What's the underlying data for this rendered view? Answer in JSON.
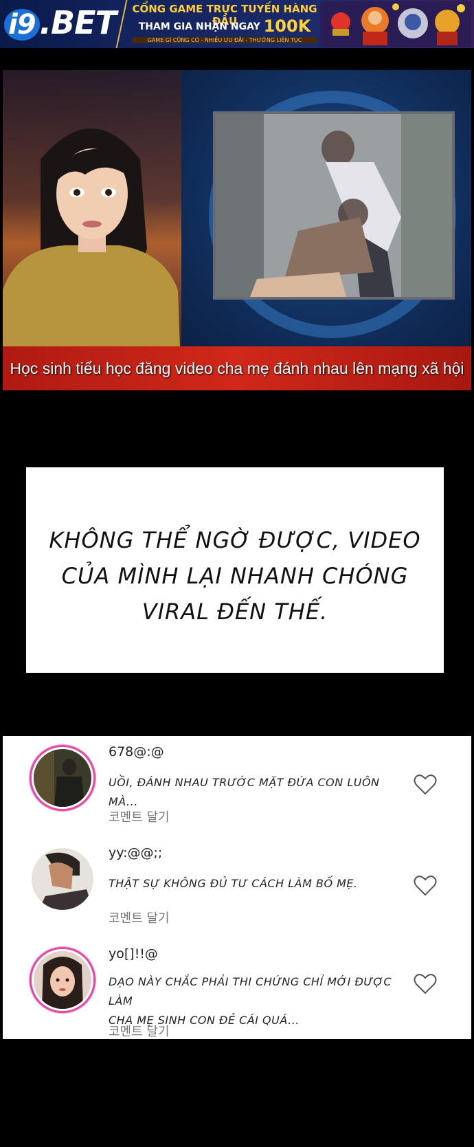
{
  "ad_banner": {
    "logo_text": ".BET",
    "logo_prefix": "i9",
    "line1": "CỔNG GAME TRỰC TUYẾN HÀNG ĐẦU",
    "line2_prefix": "THAM GIA NHẬN NGAY",
    "line2_amount": "100K",
    "line3": "GAME GÌ CŨNG CÓ - NHIỀU ƯU ĐÃI - THƯỞNG LIÊN TỤC",
    "accent_color": "#ffcf3a"
  },
  "news": {
    "caption": "Học sinh tiểu học đăng video cha mẹ đánh nhau lên mạng xã hội",
    "caption_bar_color": "#c8241a"
  },
  "speech": {
    "lines": [
      "KHÔNG THỂ NGỜ ĐƯỢC, VIDEO",
      "CỦA MÌNH LẠI NHANH CHÓNG",
      "VIRAL ĐẾN THẾ."
    ]
  },
  "comments": [
    {
      "username": "678@:@",
      "lines": [
        "UỒI, ĐÁNH NHAU TRƯỚC MẶT ĐỨA CON LUÔN MÀ..."
      ],
      "reply_label": "코멘트 달기",
      "avatar": "avatar-dark-figure",
      "like_icon": "heart-outline-icon"
    },
    {
      "username": "yy:@@;;",
      "lines": [
        "THẬT SỰ KHÔNG ĐỦ TƯ CÁCH LÀM BỐ MẸ."
      ],
      "reply_label": "코멘트 달기",
      "avatar": "avatar-man-profile",
      "like_icon": "heart-outline-icon"
    },
    {
      "username": "yo[]!!@",
      "lines": [
        "DẠO NÀY CHẮC PHẢI THI CHỨNG CHỈ MỚI ĐƯỢC LÀM",
        "CHA MẸ SINH CON ĐẺ CÁI QUÁ..."
      ],
      "reply_label": "코멘트 달기",
      "avatar": "avatar-woman-portrait",
      "like_icon": "heart-outline-icon"
    }
  ]
}
